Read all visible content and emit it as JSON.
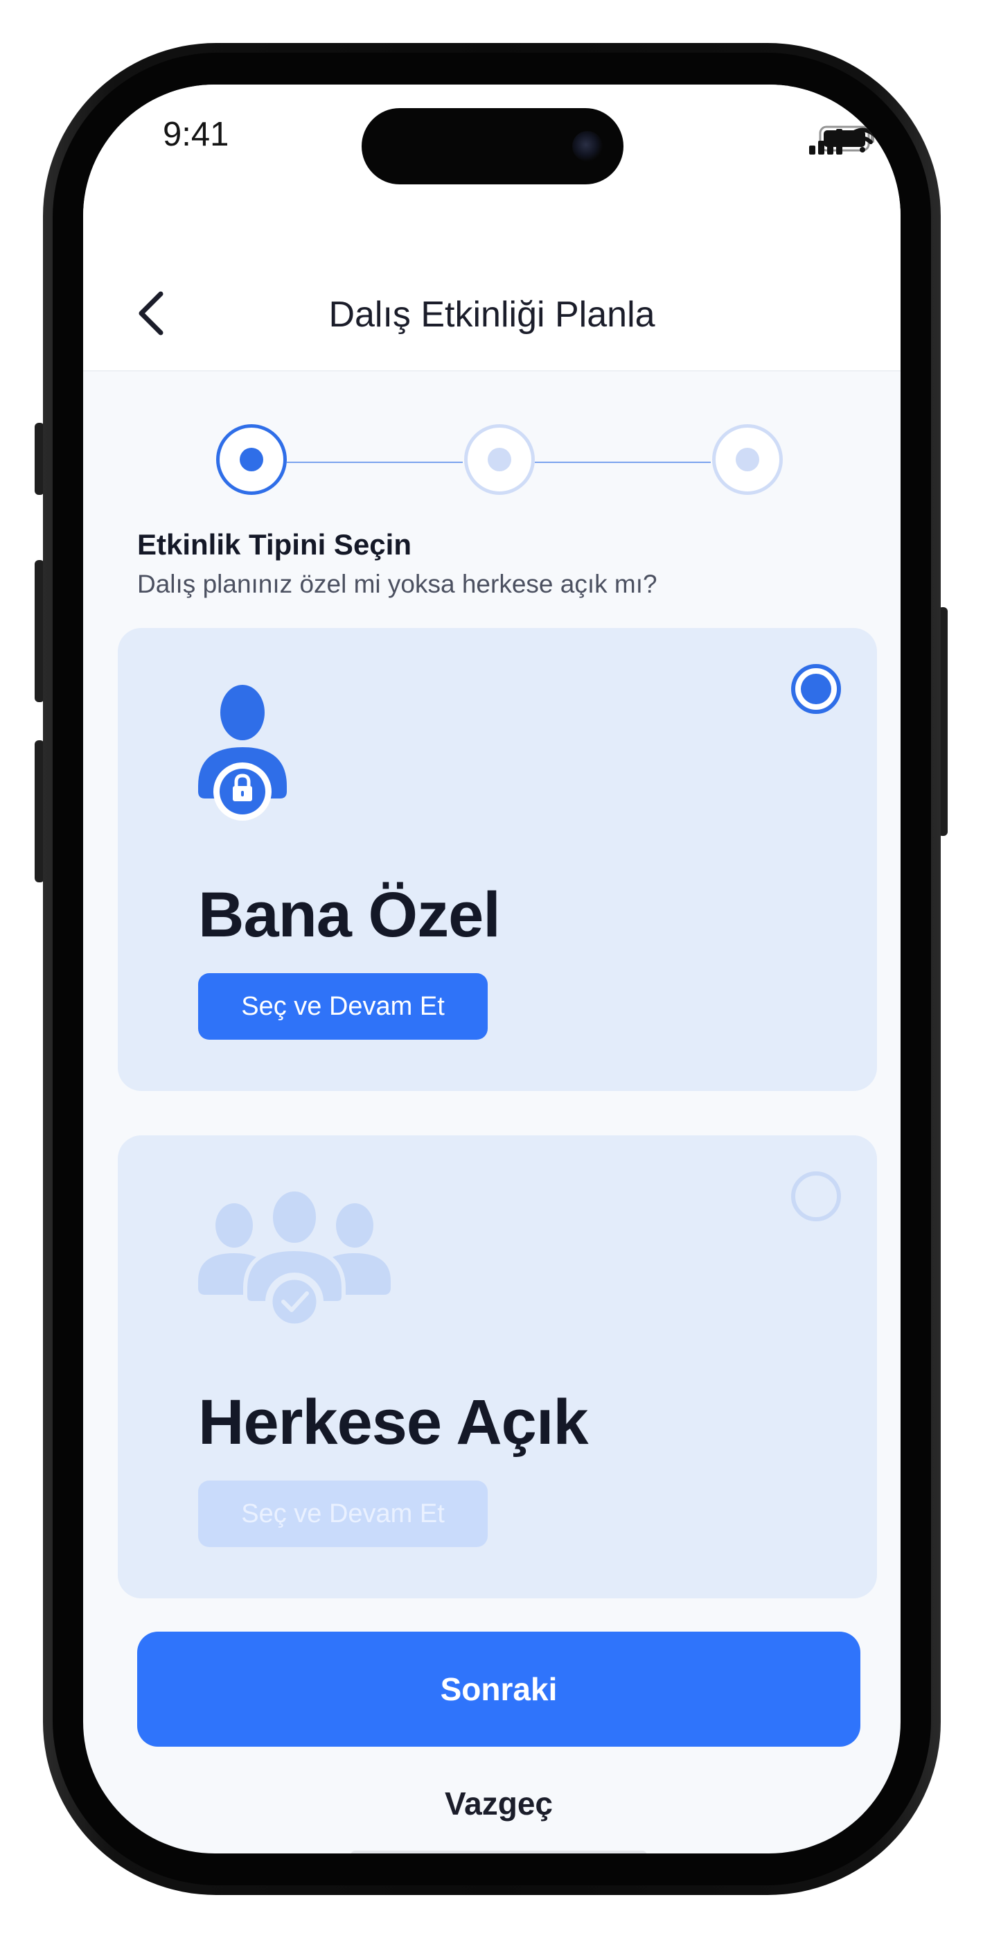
{
  "status_bar": {
    "time": "9:41"
  },
  "header": {
    "title": "Dalış Etkinliği Planla"
  },
  "stepper": {
    "steps": [
      {
        "state": "active"
      },
      {
        "state": "inactive"
      },
      {
        "state": "inactive"
      }
    ]
  },
  "section": {
    "title": "Etkinlik Tipini Seçin",
    "subtitle": "Dalış planınız özel mi  yoksa herkese açık mı?"
  },
  "options": [
    {
      "title": "Bana Özel",
      "button_label": "Seç ve Devam Et",
      "selected": true,
      "icon": "private-user-lock-icon"
    },
    {
      "title": "Herkese Açık",
      "button_label": "Seç ve Devam Et",
      "selected": false,
      "icon": "public-group-check-icon"
    }
  ],
  "actions": {
    "next_label": "Sonraki",
    "cancel_label": "Vazgeç"
  },
  "colors": {
    "accent": "#2F74FB",
    "card_background": "#E3ECFA",
    "disabled": "#C9DBFB",
    "text_dark": "#141827"
  }
}
